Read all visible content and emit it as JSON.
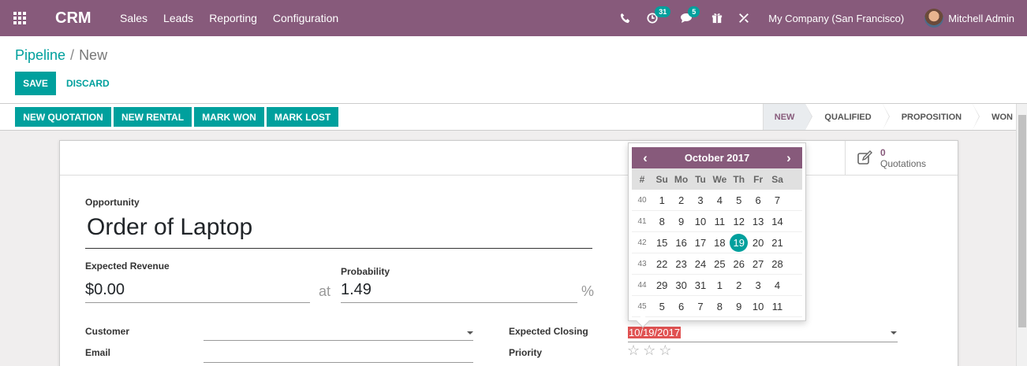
{
  "navbar": {
    "app_name": "CRM",
    "menu": [
      "Sales",
      "Leads",
      "Reporting",
      "Configuration"
    ],
    "activities_badge": "31",
    "messages_badge": "5",
    "company": "My Company (San Francisco)",
    "user": "Mitchell Admin",
    "bg_color": "#875a7b"
  },
  "breadcrumb": {
    "parent": "Pipeline",
    "separator": "/",
    "current": "New"
  },
  "buttons": {
    "save": "SAVE",
    "discard": "DISCARD"
  },
  "actions": [
    "NEW QUOTATION",
    "NEW RENTAL",
    "MARK WON",
    "MARK LOST"
  ],
  "stages": {
    "items": [
      "NEW",
      "QUALIFIED",
      "PROPOSITION",
      "WON"
    ],
    "active": "NEW"
  },
  "smart_buttons": {
    "quotations_value": "0",
    "quotations_label": "Quotations"
  },
  "form": {
    "opportunity_label": "Opportunity",
    "opportunity_name": "Order of Laptop",
    "expected_revenue_label": "Expected Revenue",
    "expected_revenue": "$0.00",
    "at_label": "at",
    "probability_label": "Probability",
    "probability": "1.49",
    "percent_sign": "%",
    "customer_label": "Customer",
    "email_label": "Email",
    "expected_closing_label": "Expected Closing",
    "expected_closing": "10/19/2017",
    "priority_label": "Priority",
    "priority_stars": 0
  },
  "datepicker": {
    "month_label": "October 2017",
    "week_header": "#",
    "days_of_week": [
      "Su",
      "Mo",
      "Tu",
      "We",
      "Th",
      "Fr",
      "Sa"
    ],
    "weeks": [
      {
        "week": "40",
        "days": [
          "1",
          "2",
          "3",
          "4",
          "5",
          "6",
          "7"
        ]
      },
      {
        "week": "41",
        "days": [
          "8",
          "9",
          "10",
          "11",
          "12",
          "13",
          "14"
        ]
      },
      {
        "week": "42",
        "days": [
          "15",
          "16",
          "17",
          "18",
          "19",
          "20",
          "21"
        ]
      },
      {
        "week": "43",
        "days": [
          "22",
          "23",
          "24",
          "25",
          "26",
          "27",
          "28"
        ]
      },
      {
        "week": "44",
        "days": [
          "29",
          "30",
          "31",
          "1",
          "2",
          "3",
          "4"
        ]
      },
      {
        "week": "45",
        "days": [
          "5",
          "6",
          "7",
          "8",
          "9",
          "10",
          "11"
        ]
      }
    ],
    "selected_day": "19",
    "accent_color": "#00a09d"
  }
}
